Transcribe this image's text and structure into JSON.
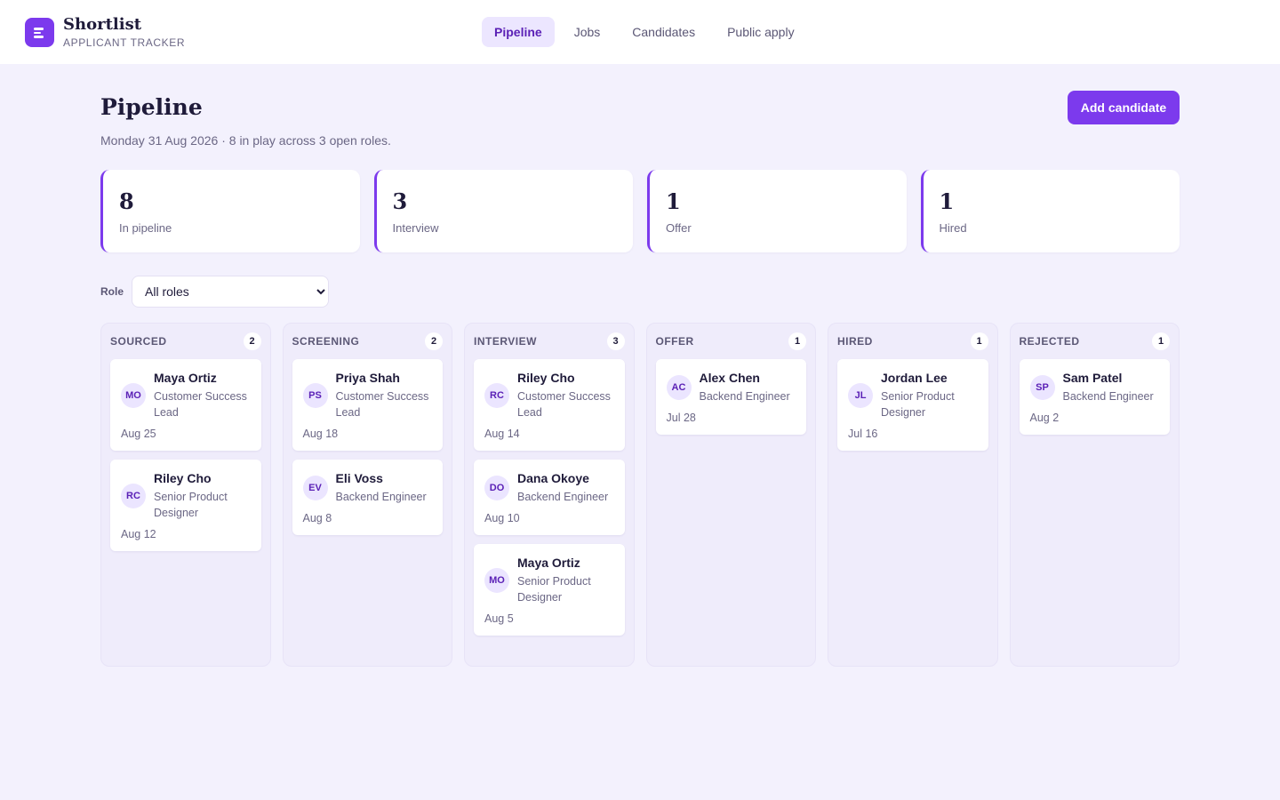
{
  "brand": {
    "name": "Shortlist",
    "subtitle": "APPLICANT TRACKER"
  },
  "nav": [
    {
      "label": "Pipeline",
      "active": true
    },
    {
      "label": "Jobs",
      "active": false
    },
    {
      "label": "Candidates",
      "active": false
    },
    {
      "label": "Public apply",
      "active": false
    }
  ],
  "page": {
    "title": "Pipeline",
    "subtitle": "Monday 31 Aug 2026 · 8 in play across 3 open roles.",
    "add_button": "Add candidate"
  },
  "stats": [
    {
      "value": "8",
      "label": "In pipeline"
    },
    {
      "value": "3",
      "label": "Interview"
    },
    {
      "value": "1",
      "label": "Offer"
    },
    {
      "value": "1",
      "label": "Hired"
    }
  ],
  "filter": {
    "label": "Role",
    "selected": "All roles"
  },
  "colors": {
    "accent": "#7c3aed",
    "background": "#f3f1fd",
    "avatar_bg": "#ebe5ff"
  },
  "columns": [
    {
      "title": "SOURCED",
      "count": "2",
      "cards": [
        {
          "initials": "MO",
          "name": "Maya Ortiz",
          "role": "Customer Success Lead",
          "date": "Aug 25"
        },
        {
          "initials": "RC",
          "name": "Riley Cho",
          "role": "Senior Product Designer",
          "date": "Aug 12"
        }
      ]
    },
    {
      "title": "SCREENING",
      "count": "2",
      "cards": [
        {
          "initials": "PS",
          "name": "Priya Shah",
          "role": "Customer Success Lead",
          "date": "Aug 18"
        },
        {
          "initials": "EV",
          "name": "Eli Voss",
          "role": "Backend Engineer",
          "date": "Aug 8"
        }
      ]
    },
    {
      "title": "INTERVIEW",
      "count": "3",
      "cards": [
        {
          "initials": "RC",
          "name": "Riley Cho",
          "role": "Customer Success Lead",
          "date": "Aug 14"
        },
        {
          "initials": "DO",
          "name": "Dana Okoye",
          "role": "Backend Engineer",
          "date": "Aug 10"
        },
        {
          "initials": "MO",
          "name": "Maya Ortiz",
          "role": "Senior Product Designer",
          "date": "Aug 5"
        }
      ]
    },
    {
      "title": "OFFER",
      "count": "1",
      "cards": [
        {
          "initials": "AC",
          "name": "Alex Chen",
          "role": "Backend Engineer",
          "date": "Jul 28"
        }
      ]
    },
    {
      "title": "HIRED",
      "count": "1",
      "cards": [
        {
          "initials": "JL",
          "name": "Jordan Lee",
          "role": "Senior Product Designer",
          "date": "Jul 16"
        }
      ]
    },
    {
      "title": "REJECTED",
      "count": "1",
      "cards": [
        {
          "initials": "SP",
          "name": "Sam Patel",
          "role": "Backend Engineer",
          "date": "Aug 2"
        }
      ]
    }
  ]
}
